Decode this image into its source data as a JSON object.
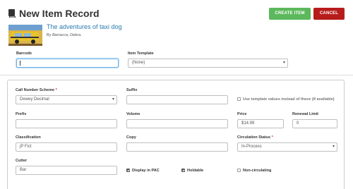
{
  "header": {
    "title": "New Item Record",
    "create_label": "CREATE ITEM",
    "cancel_label": "CANCEL"
  },
  "book": {
    "title": "The adventures of taxi dog",
    "author_prefix": "By",
    "author": "Barracca, Debra."
  },
  "top_fields": {
    "barcode_label": "Barcode",
    "barcode_value": "",
    "template_label": "Item Template",
    "template_value": "(None)"
  },
  "form": {
    "call_number_scheme_label": "Call Number Scheme",
    "call_number_scheme_value": "Dewey Decimal",
    "suffix_label": "Suffix",
    "suffix_value": "",
    "use_template_label": "Use template values instead of these (if available)",
    "prefix_label": "Prefix",
    "prefix_value": "",
    "volume_label": "Volume",
    "volume_value": "",
    "price_label": "Price",
    "price_value": "$14.99",
    "renewal_label": "Renewal Limit",
    "renewal_value": "0",
    "classification_label": "Classification",
    "classification_value": "jP Fict",
    "copy_label": "Copy",
    "copy_value": "",
    "circulation_label": "Circulation Status",
    "circulation_value": "In-Process",
    "cutter_label": "Cutter",
    "cutter_value": "Bar",
    "display_pac_label": "Display in PAC",
    "holdable_label": "Holdable",
    "non_circ_label": "Non-circulating",
    "required_mark": "*"
  },
  "colors": {
    "create": "#5cb85c",
    "cancel": "#b71c1c",
    "link": "#2a7ab0"
  },
  "icons": {
    "title": "book-icon",
    "select": "chevron-down-icon"
  }
}
